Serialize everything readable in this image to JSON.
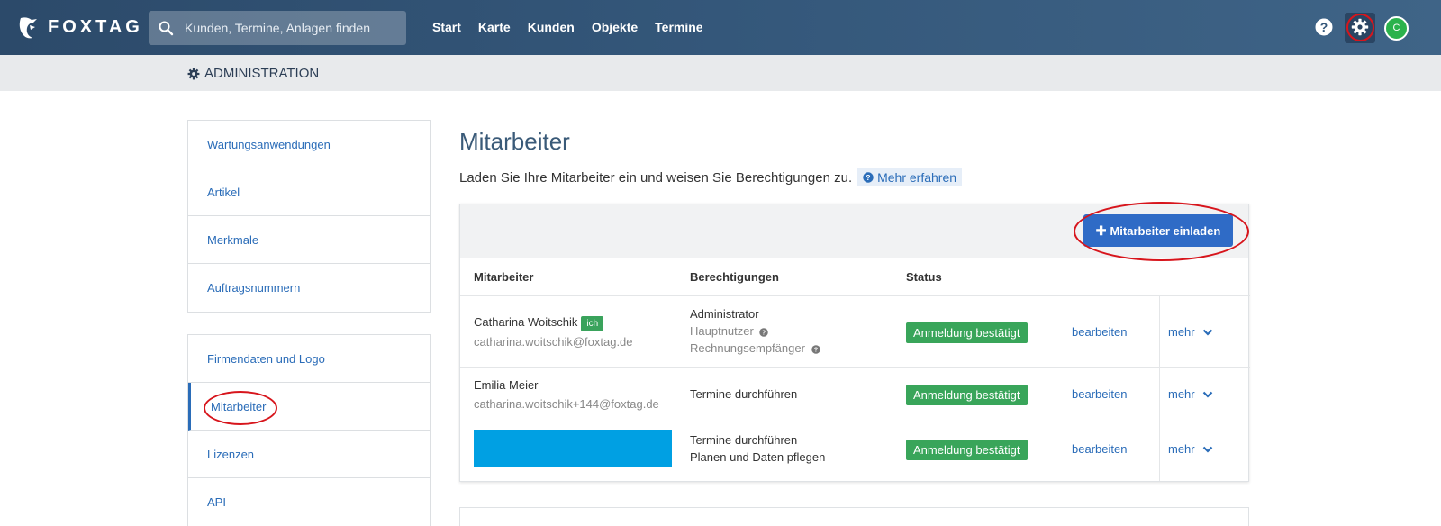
{
  "brand": {
    "name": "FOXTAG"
  },
  "search": {
    "placeholder": "Kunden, Termine, Anlagen finden"
  },
  "nav": {
    "links": [
      "Start",
      "Karte",
      "Kunden",
      "Objekte",
      "Termine"
    ]
  },
  "user": {
    "initial": "C"
  },
  "subheader": {
    "title": "ADMINISTRATION"
  },
  "sidebar": {
    "group1": [
      "Wartungsanwendungen",
      "Artikel",
      "Merkmale",
      "Auftragsnummern"
    ],
    "group2": [
      "Firmendaten und Logo",
      "Mitarbeiter",
      "Lizenzen",
      "API"
    ],
    "active": "Mitarbeiter"
  },
  "main": {
    "title": "Mitarbeiter",
    "description": "Laden Sie Ihre Mitarbeiter ein und weisen Sie Berechtigungen zu.",
    "learn_more": "Mehr erfahren",
    "invite_button": "Mitarbeiter einladen",
    "columns": [
      "Mitarbeiter",
      "Berechtigungen",
      "Status"
    ],
    "rows": [
      {
        "name": "Catharina Woitschik",
        "me_badge": "ich",
        "email": "catharina.woitschik@foxtag.de",
        "permissions": [
          "Administrator"
        ],
        "extra_roles": [
          "Hauptnutzer",
          "Rechnungsempfänger"
        ],
        "status": "Anmeldung bestätigt",
        "edit": "bearbeiten",
        "more": "mehr"
      },
      {
        "name": "Emilia Meier",
        "email": "catharina.woitschik+144@foxtag.de",
        "permissions": [
          "Termine durchführen"
        ],
        "status": "Anmeldung bestätigt",
        "edit": "bearbeiten",
        "more": "mehr"
      },
      {
        "name": "",
        "email": "",
        "permissions": [
          "Termine durchführen",
          "Planen und Daten pflegen"
        ],
        "status": "Anmeldung bestätigt",
        "edit": "bearbeiten",
        "more": "mehr"
      }
    ]
  },
  "colors": {
    "navbar": "#34577a",
    "link": "#2a6cb8",
    "primary_button": "#2f6bc6",
    "status_green": "#39a55a",
    "annotation_red": "#d7151c",
    "redaction": "#00a0e3"
  }
}
